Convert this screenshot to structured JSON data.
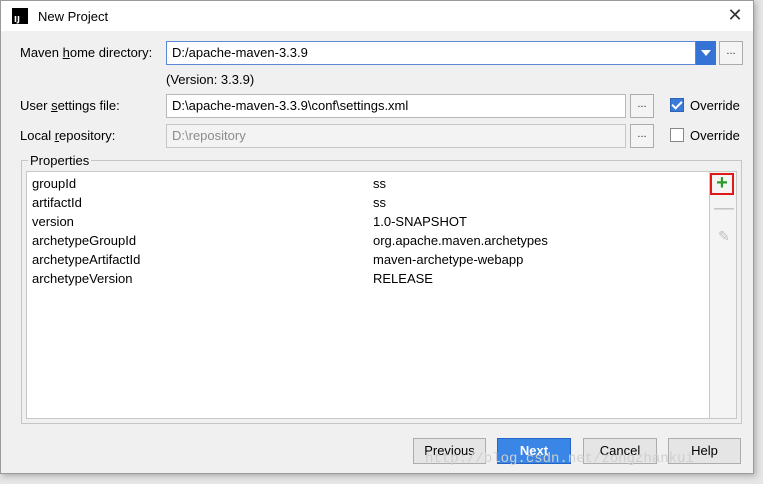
{
  "window": {
    "title": "New Project",
    "close_glyph": "✕",
    "icon_text": "IJ"
  },
  "maven_home": {
    "label_prefix": "Maven ",
    "label_mnemonic": "h",
    "label_suffix": "ome directory:",
    "value": "D:/apache-maven-3.3.9",
    "version_text": "(Version: 3.3.9)"
  },
  "user_settings": {
    "label_prefix": "User ",
    "label_mnemonic": "s",
    "label_suffix": "ettings file:",
    "value": "D:\\apache-maven-3.3.9\\conf\\settings.xml",
    "override_label": "Override",
    "override_checked": true
  },
  "local_repo": {
    "label_prefix": "Local ",
    "label_mnemonic": "r",
    "label_suffix": "epository:",
    "value": "D:\\repository",
    "override_label": "Override",
    "override_checked": false
  },
  "browse_glyph": "...",
  "properties": {
    "legend": "Properties",
    "rows": [
      {
        "key": "groupId",
        "value": "ss"
      },
      {
        "key": "artifactId",
        "value": "ss"
      },
      {
        "key": "version",
        "value": "1.0-SNAPSHOT"
      },
      {
        "key": "archetypeGroupId",
        "value": "org.apache.maven.archetypes"
      },
      {
        "key": "archetypeArtifactId",
        "value": "maven-archetype-webapp"
      },
      {
        "key": "archetypeVersion",
        "value": "RELEASE"
      }
    ],
    "tools": {
      "add": "+",
      "remove": "—",
      "edit": "✎"
    }
  },
  "buttons": {
    "previous": "Previous",
    "next": "Next",
    "cancel": "Cancel",
    "help": "Help"
  },
  "watermark": "http://blog.csdn.net/zongzhankui",
  "colors": {
    "accent": "#3a86e6",
    "highlight_border": "#e01818",
    "add_icon": "#2c9b2c"
  }
}
